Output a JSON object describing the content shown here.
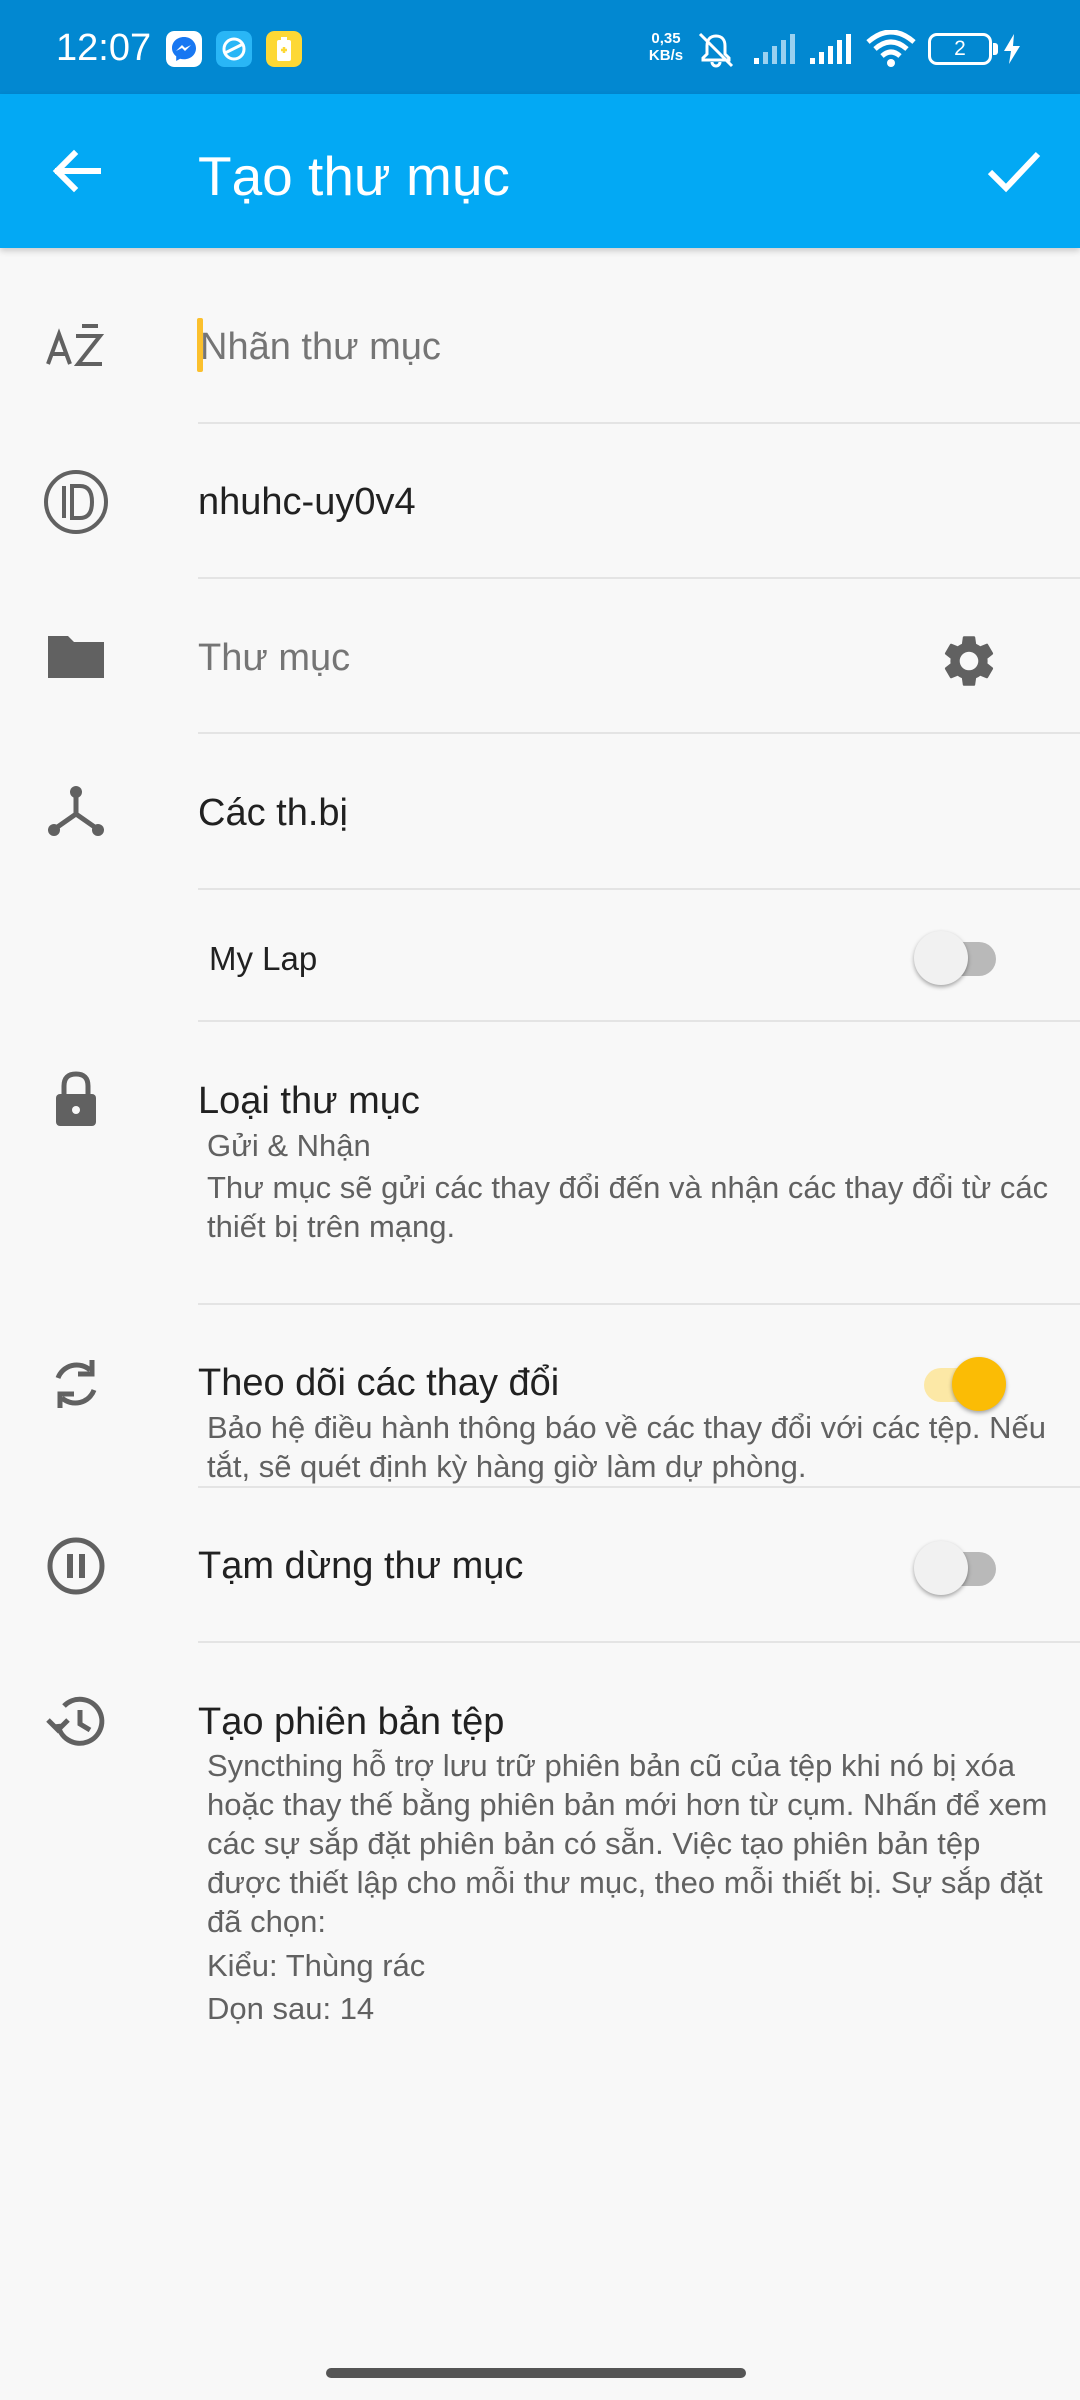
{
  "status_bar": {
    "time": "12:07",
    "net_speed_value": "0,35",
    "net_speed_unit": "KB/s",
    "battery": "2",
    "notification_icons": [
      "messenger-icon",
      "app-icon",
      "battery-saver-icon"
    ]
  },
  "app_bar": {
    "title": "Tạo thư mục",
    "back_icon": "arrow-back-icon",
    "confirm_icon": "check-icon"
  },
  "form": {
    "label_placeholder": "Nhãn thư mục",
    "id_value": "nhuhc-uy0v4",
    "path_placeholder": "Thư mục",
    "devices_title": "Các th.bị",
    "devices": [
      {
        "name": "My Lap",
        "enabled": false
      }
    ],
    "folder_type": {
      "title": "Loại thư mục",
      "value": "Gửi & Nhận",
      "description": "Thư mục sẽ gửi các thay đổi đến và nhận các thay đổi từ các thiết bị trên mạng."
    },
    "watch": {
      "title": "Theo dõi các thay đổi",
      "description": "Bảo hệ điều hành thông báo về các thay đổi với các tệp. Nếu tắt, sẽ quét định kỳ hàng giờ làm dự phòng.",
      "enabled": true
    },
    "pause": {
      "title": "Tạm dừng thư mục",
      "enabled": false
    },
    "versioning": {
      "title": "Tạo phiên bản tệp",
      "description": "Syncthing hỗ trợ lưu trữ phiên bản cũ của tệp khi nó bị xóa hoặc thay thế bằng phiên bản mới hơn từ cụm. Nhấn để xem các sự sắp đặt phiên bản có sẵn. Việc tạo phiên bản tệp được thiết lập cho mỗi thư mục, theo mỗi thiết bị. Sự sắp đặt đã chọn:",
      "type": "Kiểu: Thùng rác",
      "cleanup": "Dọn sau: 14"
    }
  },
  "colors": {
    "status_bar": "#0288d1",
    "app_bar": "#03a9f4",
    "accent": "#fbbc05",
    "icon": "#616161"
  }
}
